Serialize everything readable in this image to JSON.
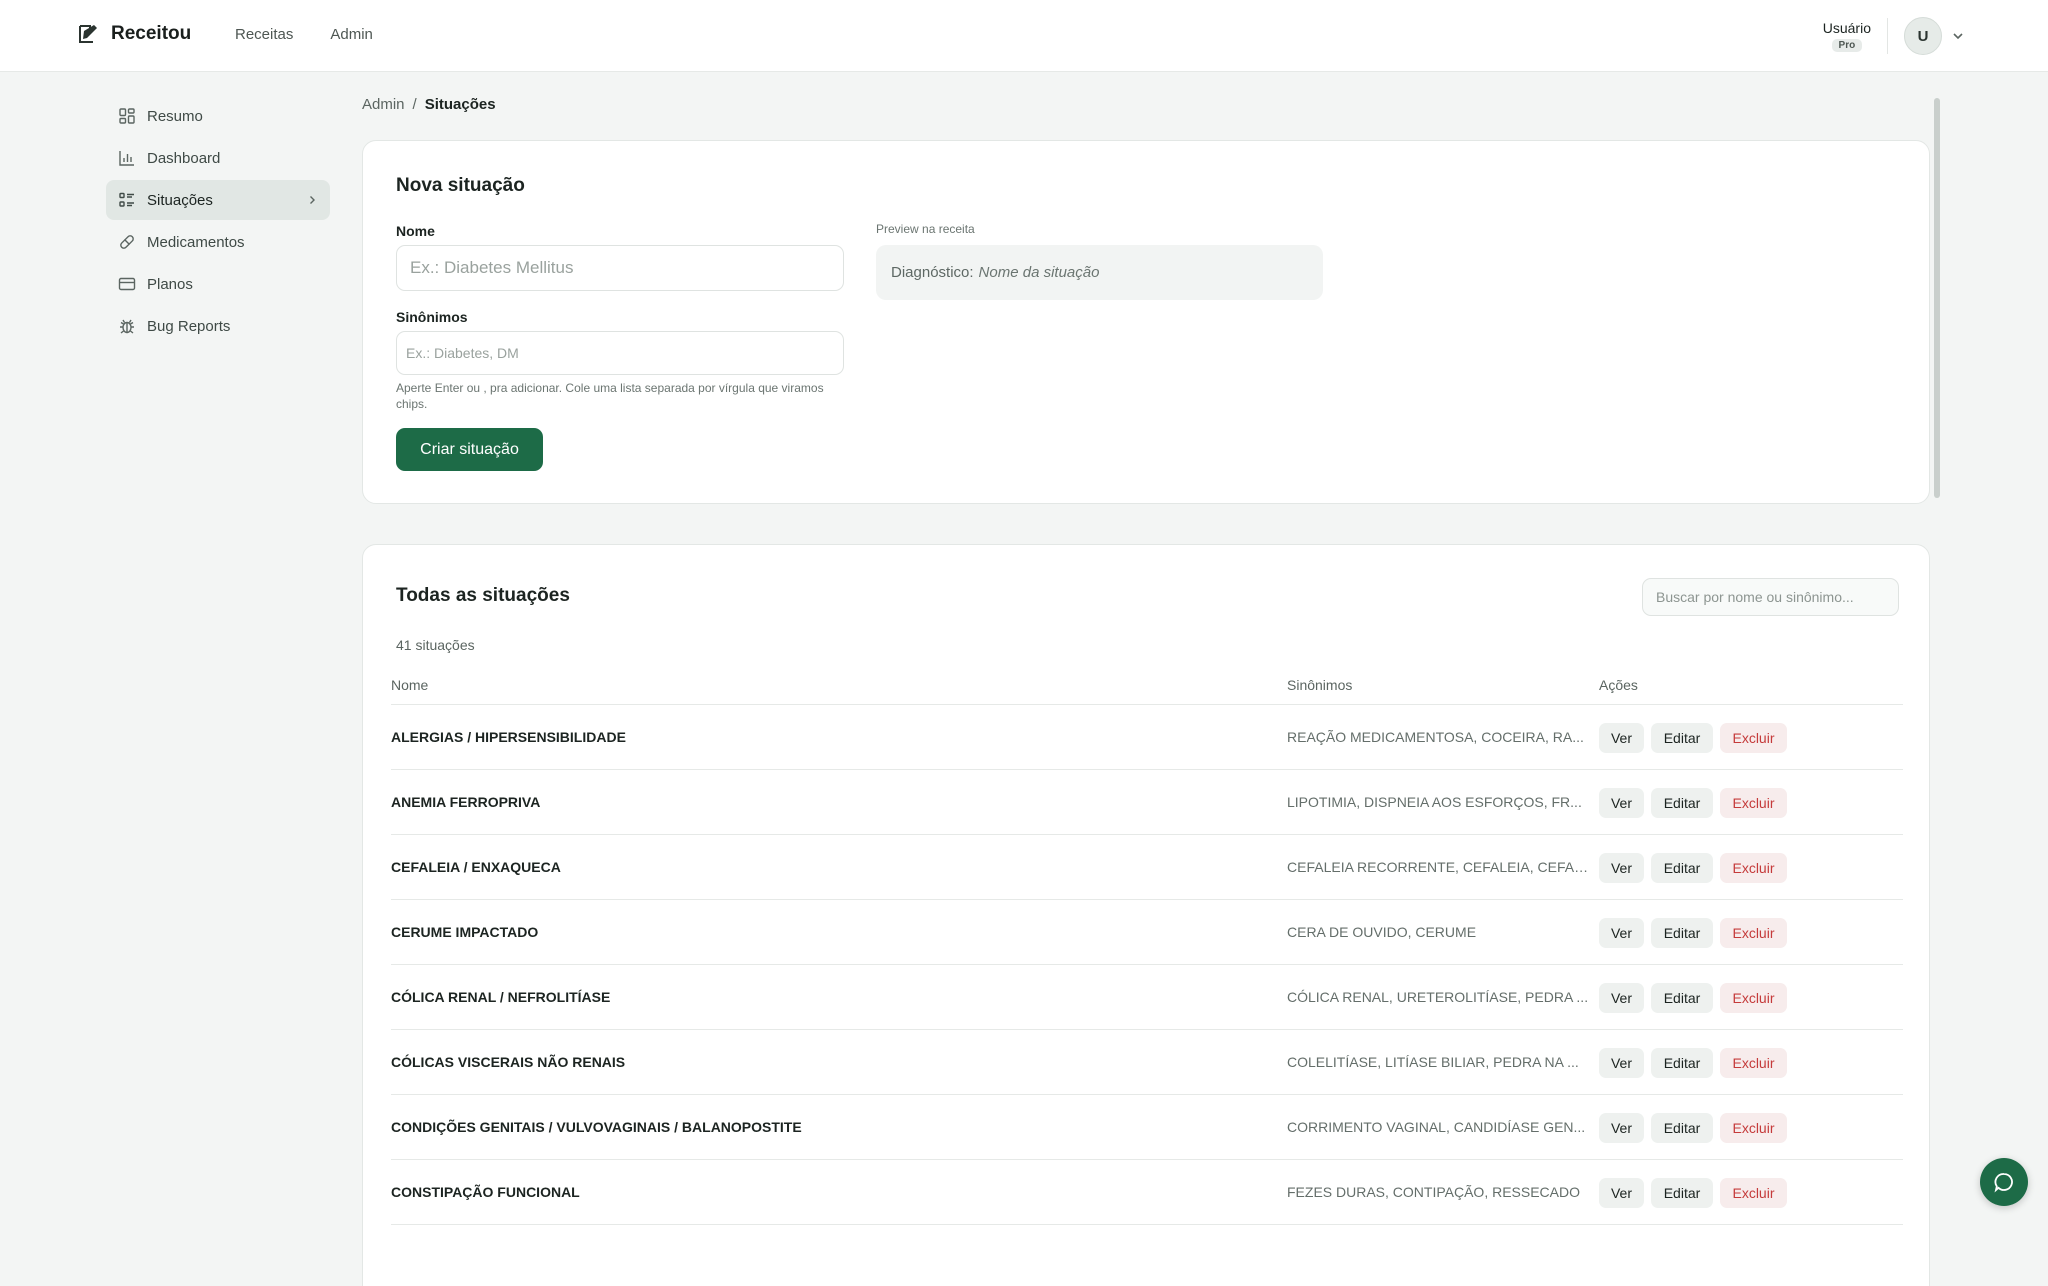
{
  "brand": {
    "name": "Receitou"
  },
  "topnav": [
    "Receitas",
    "Admin"
  ],
  "user": {
    "name": "Usuário",
    "badge": "Pro",
    "initial": "U"
  },
  "sidebar": {
    "items": [
      {
        "label": "Resumo",
        "icon": "grid-icon"
      },
      {
        "label": "Dashboard",
        "icon": "bar-chart-icon"
      },
      {
        "label": "Situações",
        "icon": "list-icon",
        "active": true
      },
      {
        "label": "Medicamentos",
        "icon": "pill-icon"
      },
      {
        "label": "Planos",
        "icon": "card-icon"
      },
      {
        "label": "Bug Reports",
        "icon": "bug-icon"
      }
    ]
  },
  "breadcrumb": {
    "parent": "Admin",
    "separator": "/",
    "current": "Situações"
  },
  "form": {
    "title": "Nova situação",
    "name_label": "Nome",
    "name_placeholder": "Ex.: Diabetes Mellitus",
    "synonyms_label": "Sinônimos",
    "synonyms_placeholder": "Ex.: Diabetes, DM",
    "hint": "Aperte Enter ou , pra adicionar. Cole uma lista separada por vírgula que viramos chips.",
    "submit": "Criar situação",
    "preview_label": "Preview na receita",
    "preview_prefix": "Diagnóstico:",
    "preview_value": "Nome da situação"
  },
  "list": {
    "title": "Todas as situações",
    "search_placeholder": "Buscar por nome ou sinônimo...",
    "count": "41 situações",
    "columns": {
      "name": "Nome",
      "synonyms": "Sinônimos",
      "actions": "Ações"
    },
    "actions": {
      "view": "Ver",
      "edit": "Editar",
      "delete": "Excluir"
    },
    "rows": [
      {
        "name": "ALERGIAS / HIPERSENSIBILIDADE",
        "synonyms": "REAÇÃO MEDICAMENTOSA, COCEIRA, RA..."
      },
      {
        "name": "ANEMIA FERROPRIVA",
        "synonyms": "LIPOTIMIA, DISPNEIA AOS ESFORÇOS, FR..."
      },
      {
        "name": "CEFALEIA / ENXAQUECA",
        "synonyms": "CEFALEIA RECORRENTE, CEFALEIA, CEFAL..."
      },
      {
        "name": "CERUME IMPACTADO",
        "synonyms": "CERA DE OUVIDO, CERUME"
      },
      {
        "name": "CÓLICA RENAL / NEFROLITÍASE",
        "synonyms": "CÓLICA RENAL, URETEROLITÍASE, PEDRA ..."
      },
      {
        "name": "CÓLICAS VISCERAIS NÃO RENAIS",
        "synonyms": "COLELITÍASE, LITÍASE BILIAR, PEDRA NA ..."
      },
      {
        "name": "CONDIÇÕES GENITAIS / VULVOVAGINAIS / BALANOPOSTITE",
        "synonyms": "CORRIMENTO VAGINAL, CANDIDÍASE GEN..."
      },
      {
        "name": "CONSTIPAÇÃO FUNCIONAL",
        "synonyms": "FEZES DURAS, CONTIPAÇÃO, RESSECADO"
      }
    ]
  },
  "colors": {
    "primary": "#1d6b47",
    "danger": "#c53b3b",
    "background": "#f3f5f4"
  }
}
